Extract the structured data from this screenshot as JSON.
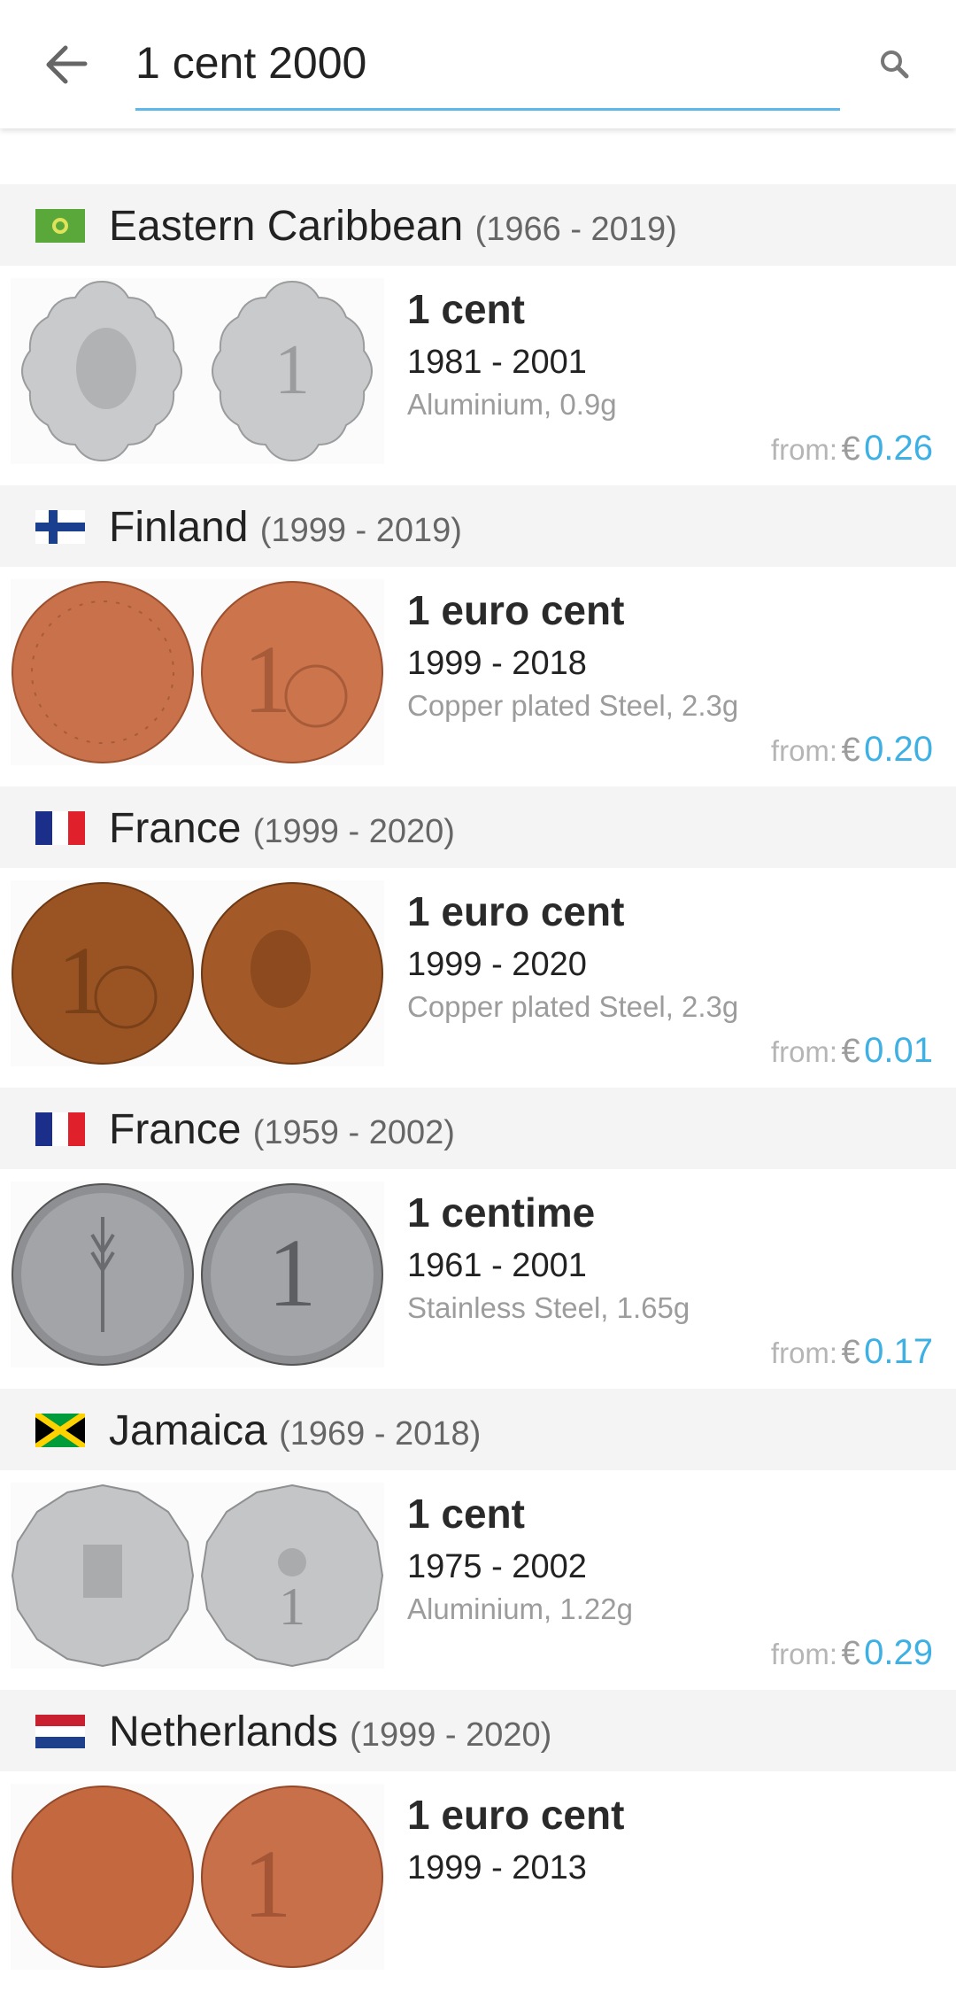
{
  "search": {
    "query": "1 cent 2000"
  },
  "groups": [
    {
      "country": "Eastern Caribbean",
      "years": "(1966 - 2019)",
      "coin": {
        "name": "1 cent",
        "years": "1981 - 2001",
        "material": "Aluminium, 0.9g",
        "price_label": "from:",
        "currency": "€",
        "price": "0.26"
      }
    },
    {
      "country": "Finland",
      "years": "(1999 - 2019)",
      "coin": {
        "name": "1 euro cent",
        "years": "1999 - 2018",
        "material": "Copper plated Steel, 2.3g",
        "price_label": "from:",
        "currency": "€",
        "price": "0.20"
      }
    },
    {
      "country": "France",
      "years": "(1999 - 2020)",
      "coin": {
        "name": "1 euro cent",
        "years": "1999 - 2020",
        "material": "Copper plated Steel, 2.3g",
        "price_label": "from:",
        "currency": "€",
        "price": "0.01"
      }
    },
    {
      "country": "France",
      "years": "(1959 - 2002)",
      "coin": {
        "name": "1 centime",
        "years": "1961 - 2001",
        "material": "Stainless Steel, 1.65g",
        "price_label": "from:",
        "currency": "€",
        "price": "0.17"
      }
    },
    {
      "country": "Jamaica",
      "years": "(1969 - 2018)",
      "coin": {
        "name": "1 cent",
        "years": "1975 - 2002",
        "material": "Aluminium, 1.22g",
        "price_label": "from:",
        "currency": "€",
        "price": "0.29"
      }
    },
    {
      "country": "Netherlands",
      "years": "(1999 - 2020)",
      "coin": {
        "name": "1 euro cent",
        "years": "1999 - 2013"
      }
    }
  ],
  "icons": {
    "back": "arrow-back-icon",
    "search": "search-icon"
  },
  "colors": {
    "accent": "#3fb0e4",
    "search_underline": "#5bb8e8",
    "header_bg": "#f4f4f4"
  }
}
